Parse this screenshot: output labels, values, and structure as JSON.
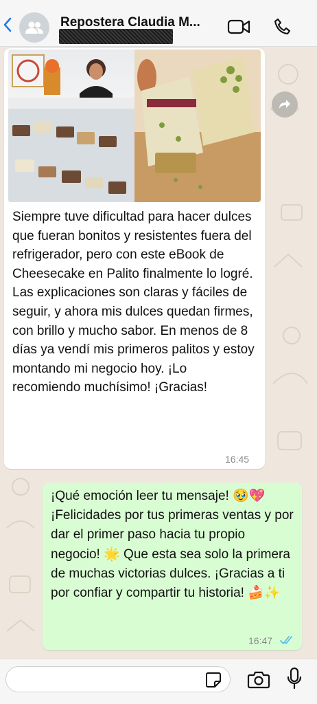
{
  "header": {
    "contact_name": "Repostera Claudia M...",
    "icons": [
      "back-arrow-icon",
      "avatar-group-icon",
      "video-call-icon",
      "phone-call-icon"
    ]
  },
  "incoming_message": {
    "text": "Siempre tuve dificultad para hacer dulces que fueran bonitos y resistentes fuera del refrigerador, pero con este eBook de Cheesecake en Palito finalmente lo logré. Las explicaciones son claras y fáciles de seguir, y ahora mis dulces quedan firmes, con brillo y mucho sabor. En menos de 8 días ya vendí mis primeros palitos y estoy montando mi negocio hoy. ¡Lo recomiendo muchísimo! ¡Gracias!",
    "time": "16:45",
    "photos": [
      "woman-behind-display-case-photo",
      "pistachio-cheesecake-photo"
    ]
  },
  "outgoing_message": {
    "text": "¡Qué emoción leer tu mensaje! 🥹💖 ¡Felicidades por tus primeras ventas y por dar el primer paso hacia tu propio negocio! 🌟 Que esta sea solo la primera de muchas victorias dulces. ¡Gracias a ti por confiar y compartir tu historia! 🍰✨",
    "time": "16:47",
    "status": "read"
  },
  "composer": {
    "input_value": "",
    "placeholder": ""
  },
  "colors": {
    "wallpaper": "#efe7dd",
    "incoming_bubble": "#ffffff",
    "outgoing_bubble": "#d9fdd3",
    "read_ticks": "#53bdeb",
    "header_bg": "#f6f6f6"
  }
}
